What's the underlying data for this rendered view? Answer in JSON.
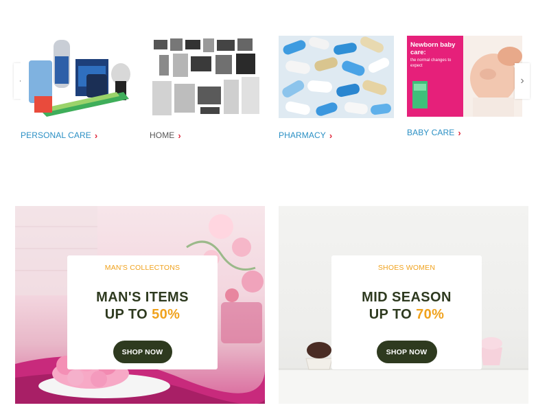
{
  "carousel": {
    "categories": [
      {
        "label": "PERSONAL CARE",
        "color": "#2a8fc4"
      },
      {
        "label": "HOME",
        "color": "#555555"
      },
      {
        "label": "PHARMACY",
        "color": "#2a8fc4"
      },
      {
        "label": "BABY CARE",
        "color": "#2a8fc4"
      }
    ],
    "baby_card_text": {
      "title": "Newborn baby care:",
      "subtitle": "the normal changes to expect"
    },
    "arrow_left_glyph": "‹",
    "arrow_right_glyph": "›",
    "chevron_glyph": "›"
  },
  "promos": [
    {
      "kicker": "MAN'S COLLECTONS",
      "headline_line1": "MAN'S ITEMS",
      "headline_line2_prefix": "UP TO ",
      "headline_percent": "50%",
      "button_label": "SHOP NOW"
    },
    {
      "kicker": "SHOES WOMEN",
      "headline_line1": "MID SEASON",
      "headline_line2_prefix": "UP TO ",
      "headline_percent": "70%",
      "button_label": "SHOP NOW"
    }
  ],
  "colors": {
    "accent_orange": "#f0a21d",
    "dark_green": "#2e3a1f",
    "link_blue": "#2a8fc4",
    "chevron_red": "#e0263a"
  }
}
